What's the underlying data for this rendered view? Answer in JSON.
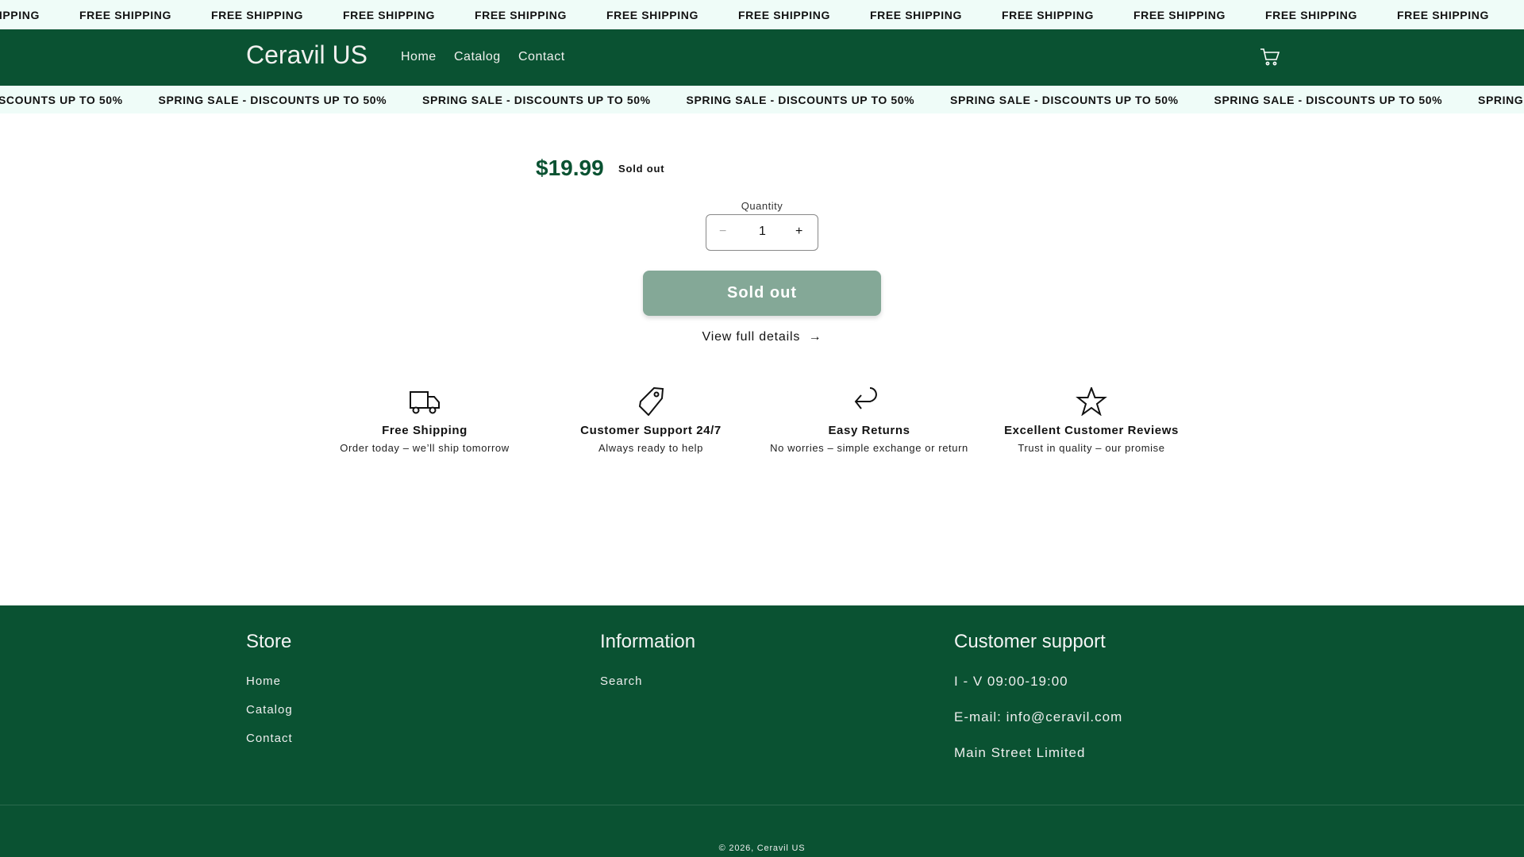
{
  "announcement": {
    "text": "FREE SHIPPING",
    "count": 12
  },
  "header": {
    "logo": "Ceravil US",
    "nav": [
      "Home",
      "Catalog",
      "Contact"
    ],
    "cart_icon": "cart-icon"
  },
  "sale_banner": {
    "text": "SPRING SALE - DISCOUNTS UP TO 50%",
    "count": 7
  },
  "product": {
    "price": "$19.99",
    "badge": "Sold out",
    "quantity_label": "Quantity",
    "quantity": "1",
    "decrease": "−",
    "increase": "+",
    "button": "Sold out",
    "details_link": "View full details",
    "details_arrow": "→"
  },
  "features": [
    {
      "icon": "truck-icon",
      "title": "Free Shipping",
      "subtitle": "Order today – we’ll ship tomorrow"
    },
    {
      "icon": "tag-icon",
      "title": "Customer Support 24/7",
      "subtitle": "Always ready to help"
    },
    {
      "icon": "return-arrow-icon",
      "title": "Easy Returns",
      "subtitle": "No worries – simple exchange or return"
    },
    {
      "icon": "star-icon",
      "title": "Excellent Customer Reviews",
      "subtitle": "Trust in quality – our promise"
    }
  ],
  "footer": {
    "store": {
      "heading": "Store",
      "links": [
        "Home",
        "Catalog",
        "Contact"
      ]
    },
    "information": {
      "heading": "Information",
      "links": [
        "Search"
      ]
    },
    "support": {
      "heading": "Customer support",
      "lines": [
        "I - V 09:00-19:00",
        "E-mail: info@ceravil.com",
        "Main Street Limited"
      ]
    },
    "copyright": "© 2026, Ceravil US"
  },
  "colors": {
    "brand": "#0a5232",
    "bar": "#effcf8",
    "button_disabled": "#84a897"
  }
}
